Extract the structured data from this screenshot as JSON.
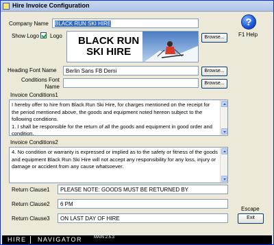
{
  "window": {
    "title": "Hire Invoice Configuration"
  },
  "company": {
    "label": "Company Name",
    "value": "BLACK RUN SKI HIRE"
  },
  "logo": {
    "show_label": "Show Logo",
    "label": "Logo",
    "checked": true,
    "text": "BLACK RUN\nSKI HIRE"
  },
  "heading_font": {
    "label": "Heading Font Name",
    "value": "Berlin Sans FB Demi"
  },
  "conditions_font": {
    "label": "Conditions Font Name",
    "value": ""
  },
  "browse_label": "Browse...",
  "conditions1": {
    "label": "Invoice Conditions1",
    "text": "I hereby offer to hire from Black Run Ski Hire, for charges mentioned on the receipt for the period mentioned above, the goods and equipment noted hereon subject to the following conditions.\n1. I shall be responsible for the return of all the goods and equipment in good order and condition."
  },
  "conditions2": {
    "label": "Invoice Conditions2",
    "text": "4. No condition or warranty is expressed or implied as to the safety or fitness of the goods and equipment Black Run Ski Hire will not accept any responsibility for any loss, injury or damage or accident from any cause whatsoever."
  },
  "return1": {
    "label": "Return Clause1",
    "value": "PLEASE NOTE: GOODS MUST BE RETURNED BY"
  },
  "return2": {
    "label": "Return Clause2",
    "value": "6 PM"
  },
  "return3": {
    "label": "Return Clause3",
    "value": "ON LAST DAY OF HIRE"
  },
  "help": {
    "glyph": "?",
    "label": "F1  Help"
  },
  "escape": {
    "label": "Escape",
    "button": "Exit"
  },
  "footer": {
    "brand_left": "HIRE",
    "brand_right": "NAVIGATOR",
    "version": "MAIN 2.5.3"
  },
  "colors": {
    "selection": "#316ac5",
    "window_bg": "#ece9d8",
    "border": "#7f9db9",
    "title_bar": "#c8d8f0"
  }
}
